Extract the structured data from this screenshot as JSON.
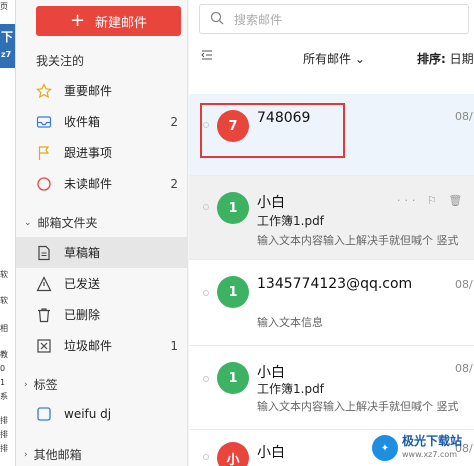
{
  "bg_strip": {
    "lines": [
      "页",
      "下",
      "z7",
      "软",
      "软",
      "相",
      "教",
      "0",
      "1",
      "系",
      "排",
      "排",
      "排"
    ]
  },
  "sidebar": {
    "new_mail_label": "新建邮件",
    "followed_title": "我关注的",
    "followed_items": [
      {
        "label": "重要邮件",
        "count": ""
      },
      {
        "label": "收件箱",
        "count": "2"
      },
      {
        "label": "跟进事项",
        "count": ""
      },
      {
        "label": "未读邮件",
        "count": "2"
      }
    ],
    "folders_title": "邮箱文件夹",
    "folder_items": [
      {
        "label": "草稿箱",
        "count": ""
      },
      {
        "label": "已发送",
        "count": ""
      },
      {
        "label": "已删除",
        "count": ""
      },
      {
        "label": "垃圾邮件",
        "count": "1"
      }
    ],
    "tags_title": "标签",
    "tag_items": [
      {
        "label": "weifu dj"
      }
    ],
    "other_title": "其他邮箱"
  },
  "main": {
    "search_placeholder": "搜索邮件",
    "filter_label": "所有邮件",
    "sort_label": "排序:",
    "sort_value": "日期"
  },
  "mails": [
    {
      "avatar": "7",
      "avatar_color": "#e8453c",
      "sender": "748069",
      "subject": "",
      "preview": "",
      "date": "08/"
    },
    {
      "avatar": "1",
      "avatar_color": "#3cb262",
      "sender": "小白",
      "subject": "工作簿1.pdf",
      "preview": "输入文本内容输入上解决手就但喊个 竖式",
      "date": "08/"
    },
    {
      "avatar": "1",
      "avatar_color": "#3cb262",
      "sender": "1345774123@qq.com",
      "subject": "",
      "preview": "输入文本信息",
      "date": "08/"
    },
    {
      "avatar": "1",
      "avatar_color": "#3cb262",
      "sender": "小白",
      "subject": "工作簿1.pdf",
      "preview": "输入文本内容输入上解决手就但喊个 竖式",
      "date": "08/"
    },
    {
      "avatar": "小",
      "avatar_color": "#e8453c",
      "sender": "小白",
      "subject": "",
      "preview": "",
      "date": "08/"
    }
  ],
  "watermark": {
    "name": "极光下载站",
    "url": "www.xz7.com"
  },
  "colors": {
    "accent": "#e8453c",
    "green": "#3cb262"
  }
}
